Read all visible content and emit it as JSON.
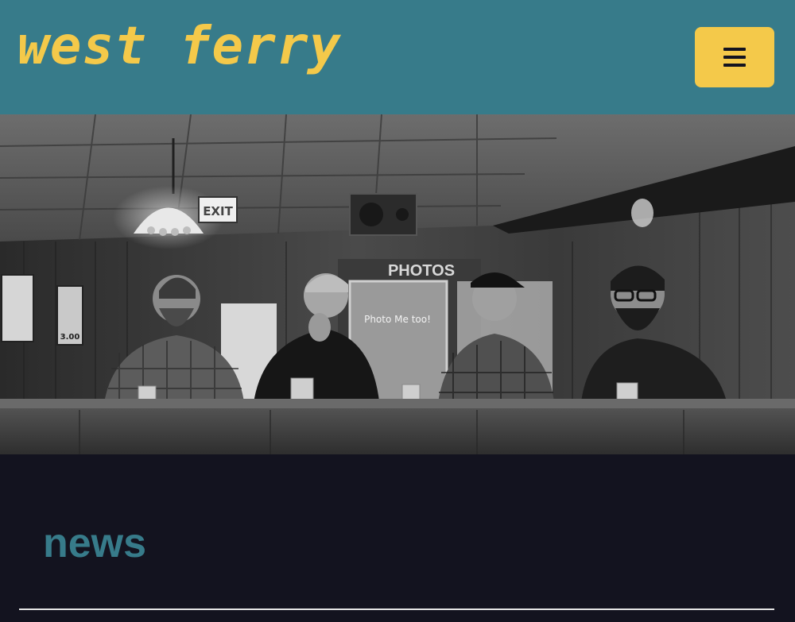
{
  "header": {
    "site_title": "west ferry",
    "menu_icon": "hamburger-icon",
    "menu_button_color": "#f4c94a",
    "background_color": "#377b8a"
  },
  "hero": {
    "sign_exit": "EXIT",
    "sign_photos": "PHOTOS",
    "poster_text": "Photo Me too!",
    "flyer_price": "3.00"
  },
  "news": {
    "heading": "news",
    "heading_color": "#377b8a"
  },
  "colors": {
    "page_background": "#13131f",
    "accent_yellow": "#f4c94a",
    "accent_teal": "#377b8a"
  }
}
